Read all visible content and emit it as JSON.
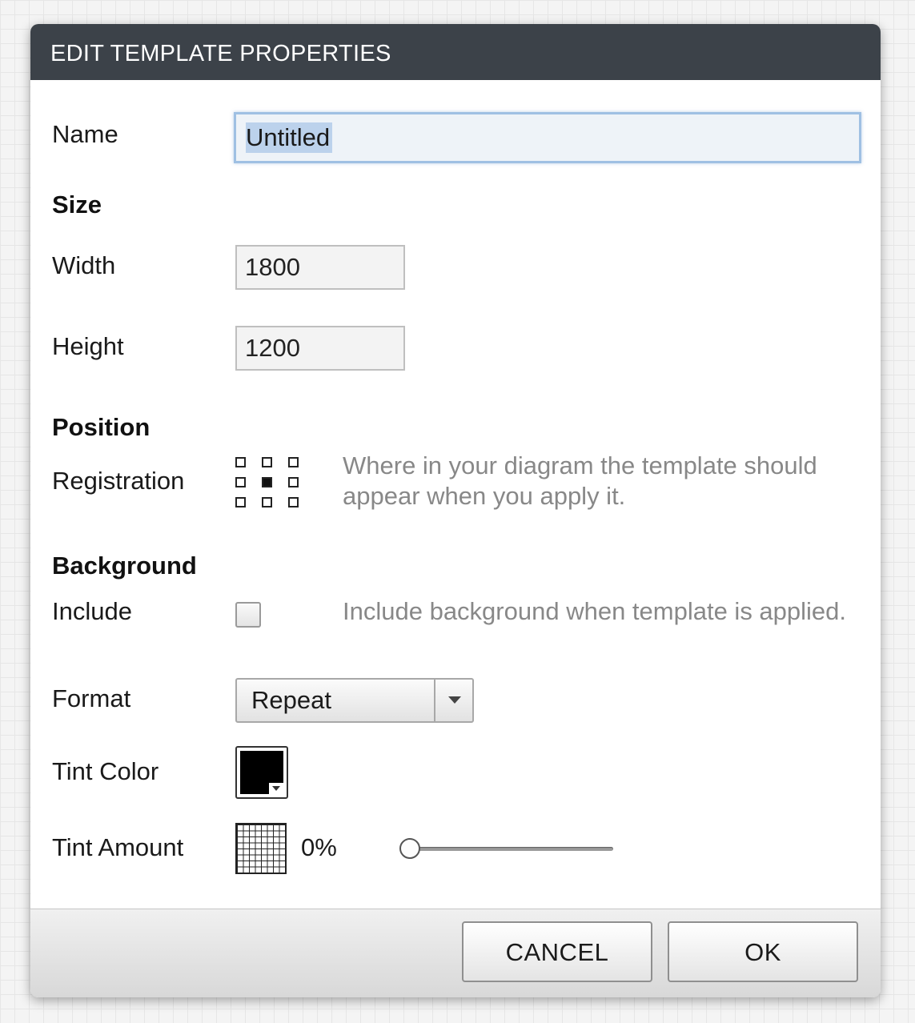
{
  "dialog": {
    "title": "EDIT TEMPLATE PROPERTIES"
  },
  "name": {
    "label": "Name",
    "value": "Untitled"
  },
  "size": {
    "heading": "Size",
    "width_label": "Width",
    "width_value": "1800",
    "height_label": "Height",
    "height_value": "1200"
  },
  "position": {
    "heading": "Position",
    "registration_label": "Registration",
    "registration_selected": "center",
    "hint": "Where in your diagram the template should appear when you apply it."
  },
  "background": {
    "heading": "Background",
    "include_label": "Include",
    "include_checked": false,
    "include_hint": "Include background when template is applied.",
    "format_label": "Format",
    "format_value": "Repeat",
    "tint_color_label": "Tint Color",
    "tint_color": "#000000",
    "tint_amount_label": "Tint Amount",
    "tint_amount_value": "0%",
    "tint_amount_fraction": 0
  },
  "footer": {
    "cancel_label": "CANCEL",
    "ok_label": "OK"
  },
  "icons": {
    "format_dropdown": "chevron-down-icon",
    "tint_grid": "grid-icon",
    "tint_swatch": "color-swatch-icon",
    "registration": "registration-grid-icon"
  }
}
